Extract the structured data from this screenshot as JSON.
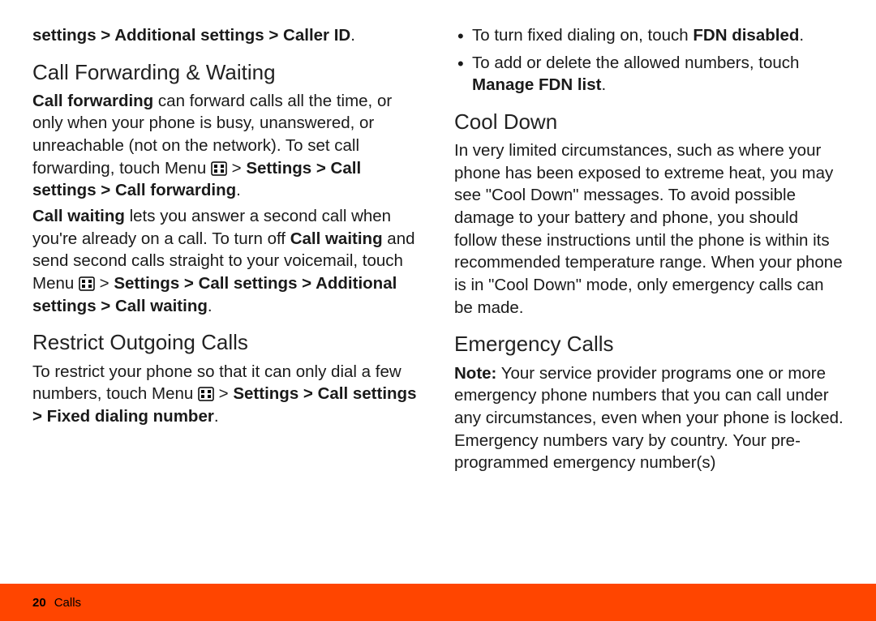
{
  "left": {
    "intro_bold": "settings > Additional settings > Caller ID",
    "intro_end": ".",
    "h1": "Call Forwarding & Waiting",
    "p1_b1": "Call forwarding",
    "p1_t1": " can forward calls all the time, or only when your phone is busy, unanswered, or unreachable (not on the network). To set call forwarding, touch Menu ",
    "p1_t2": " > ",
    "p1_b2": "Settings > Call settings > Call forwarding",
    "p1_t3": ".",
    "p2_b1": "Call waiting",
    "p2_t1": " lets you answer a second call when you're already on a call. To turn off ",
    "p2_b2": "Call waiting",
    "p2_t2": " and send second calls straight to your voicemail, touch Menu ",
    "p2_t3": " > ",
    "p2_b3": "Settings > Call settings > Additional settings > Call waiting",
    "p2_t4": ".",
    "h2": "Restrict Outgoing Calls",
    "p3_t1": "To restrict your phone so that it can only dial a few numbers, touch Menu ",
    "p3_t2": " > ",
    "p3_b1": "Settings > Call settings > Fixed dialing number",
    "p3_t3": "."
  },
  "right": {
    "li1_t1": "To turn fixed dialing on, touch ",
    "li1_b1": "FDN disabled",
    "li1_t2": ".",
    "li2_t1": "To add or delete the allowed numbers, touch ",
    "li2_b1": "Manage FDN list",
    "li2_t2": ".",
    "h1": "Cool Down",
    "p1": "In very limited circumstances, such as where your phone has been exposed to extreme heat, you may see \"Cool Down\" messages. To avoid possible damage to your battery and phone, you should follow these instructions until the phone is within its recommended temperature range. When your phone is in \"Cool Down\" mode, only emergency calls can be made.",
    "h2": "Emergency Calls",
    "p2_b1": "Note:",
    "p2_t1": " Your service provider programs one or more emergency phone numbers that you can call under any circumstances, even when your phone is locked. Emergency numbers vary by country. Your pre-programmed emergency number(s)"
  },
  "footer": {
    "page_num": "20",
    "section": "Calls"
  }
}
